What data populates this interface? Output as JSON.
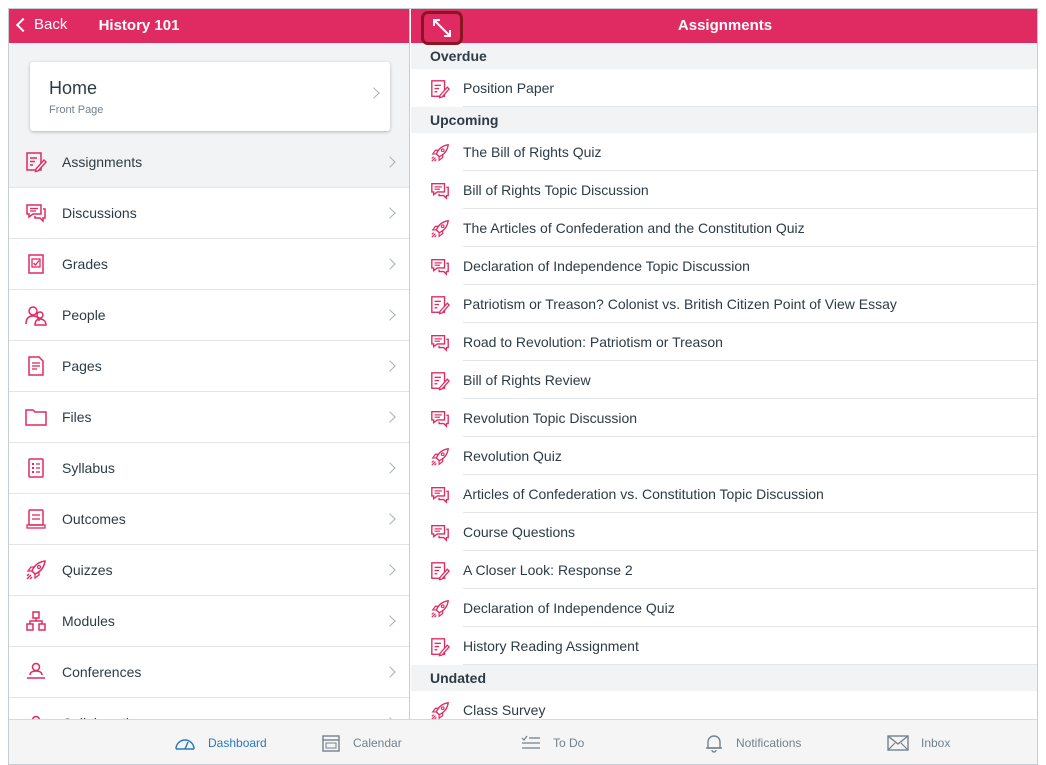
{
  "left_panel": {
    "back_label": "Back",
    "course_title": "History 101",
    "home": {
      "title": "Home",
      "subtitle": "Front Page"
    },
    "nav_items": [
      {
        "label": "Assignments",
        "icon": "assignment-icon"
      },
      {
        "label": "Discussions",
        "icon": "discussion-icon"
      },
      {
        "label": "Grades",
        "icon": "grades-icon"
      },
      {
        "label": "People",
        "icon": "people-icon"
      },
      {
        "label": "Pages",
        "icon": "pages-icon"
      },
      {
        "label": "Files",
        "icon": "folder-icon"
      },
      {
        "label": "Syllabus",
        "icon": "syllabus-icon"
      },
      {
        "label": "Outcomes",
        "icon": "outcomes-icon"
      },
      {
        "label": "Quizzes",
        "icon": "quiz-icon"
      },
      {
        "label": "Modules",
        "icon": "modules-icon"
      },
      {
        "label": "Conferences",
        "icon": "conferences-icon"
      },
      {
        "label": "Collaborations",
        "icon": "collaborations-icon"
      }
    ]
  },
  "right_panel": {
    "title": "Assignments",
    "sections": [
      {
        "name": "Overdue",
        "items": [
          {
            "label": "Position Paper",
            "type": "assignment"
          }
        ]
      },
      {
        "name": "Upcoming",
        "items": [
          {
            "label": "The Bill of Rights Quiz",
            "type": "quiz"
          },
          {
            "label": "Bill of Rights Topic Discussion",
            "type": "discussion"
          },
          {
            "label": "The Articles of Confederation and the Constitution Quiz",
            "type": "quiz"
          },
          {
            "label": "Declaration of Independence Topic Discussion",
            "type": "discussion"
          },
          {
            "label": "Patriotism or Treason? Colonist vs. British Citizen Point of View Essay",
            "type": "assignment"
          },
          {
            "label": "Road to Revolution: Patriotism or Treason",
            "type": "discussion"
          },
          {
            "label": "Bill of Rights Review",
            "type": "assignment"
          },
          {
            "label": "Revolution Topic Discussion",
            "type": "discussion"
          },
          {
            "label": "Revolution Quiz",
            "type": "quiz"
          },
          {
            "label": "Articles of Confederation vs. Constitution Topic Discussion",
            "type": "discussion"
          },
          {
            "label": "Course Questions",
            "type": "discussion"
          },
          {
            "label": "A Closer Look: Response 2",
            "type": "assignment"
          },
          {
            "label": "Declaration of Independence Quiz",
            "type": "quiz"
          },
          {
            "label": "History Reading Assignment",
            "type": "assignment"
          }
        ]
      },
      {
        "name": "Undated",
        "items": [
          {
            "label": "Class Survey",
            "type": "quiz"
          }
        ]
      }
    ]
  },
  "tabbar": [
    {
      "label": "Dashboard",
      "icon": "dashboard-icon",
      "active": true
    },
    {
      "label": "Calendar",
      "icon": "calendar-icon",
      "active": false
    },
    {
      "label": "To Do",
      "icon": "todo-icon",
      "active": false
    },
    {
      "label": "Notifications",
      "icon": "bell-icon",
      "active": false
    },
    {
      "label": "Inbox",
      "icon": "envelope-icon",
      "active": false
    }
  ],
  "colors": {
    "brand": "#e02a62",
    "active_tab": "#2a7abc",
    "text": "#2d3b45"
  }
}
